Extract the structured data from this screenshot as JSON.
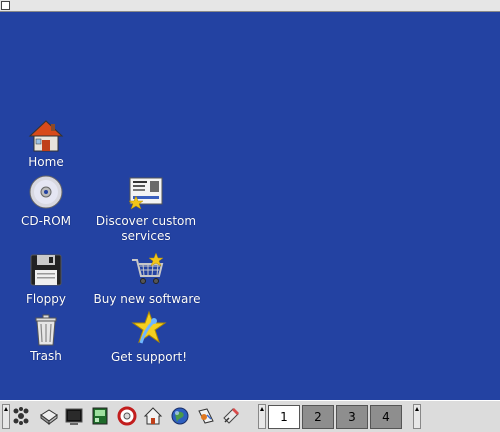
{
  "desktop": {
    "icons": [
      {
        "label": "Home",
        "icon": "home-icon"
      },
      {
        "label": "CD-ROM",
        "icon": "cdrom-icon"
      },
      {
        "label": "Discover custom services",
        "label_line1": "Discover custom",
        "label_line2": "services",
        "icon": "services-icon"
      },
      {
        "label": "Floppy",
        "icon": "floppy-icon"
      },
      {
        "label": "Buy new software",
        "icon": "cart-icon"
      },
      {
        "label": "Trash",
        "icon": "trash-icon"
      },
      {
        "label": "Get support!",
        "icon": "support-icon"
      }
    ]
  },
  "panel": {
    "launchers": [
      "main-menu-icon",
      "email-icon",
      "terminal-icon",
      "system-monitor-icon",
      "help-lifebuoy-icon",
      "home-folder-icon",
      "web-browser-icon",
      "office-icon",
      "text-editor-icon"
    ],
    "workspaces": [
      {
        "label": "1",
        "active": true
      },
      {
        "label": "2",
        "active": false
      },
      {
        "label": "3",
        "active": false
      },
      {
        "label": "4",
        "active": false
      }
    ]
  },
  "colors": {
    "desktop_bg": "#2342a2",
    "panel_bg": "#dcdcdc"
  }
}
